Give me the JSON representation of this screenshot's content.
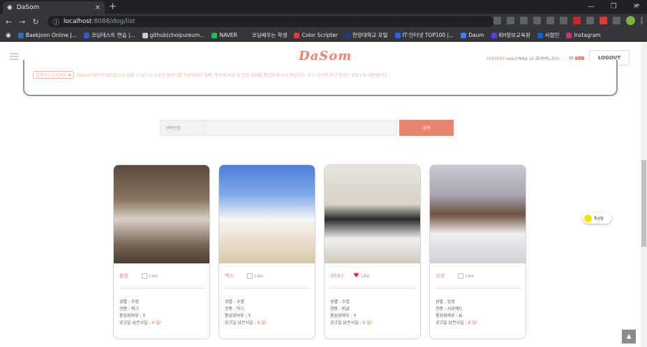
{
  "browser": {
    "tab_title": "DaSom",
    "url_host": "localhost",
    "url_rest": ":8088/dog/list",
    "bookmarks": [
      {
        "label": "Baekjoon Online J...",
        "color": "#2c6fb7"
      },
      {
        "label": "코딩테스트 연습 |...",
        "color": "#2f5bd3"
      },
      {
        "label": "github(choipureum...",
        "color": "#cccccc"
      },
      {
        "label": "NAVER",
        "color": "#03c75a"
      },
      {
        "label": "코딩배우는 학생",
        "color": "#35363a"
      },
      {
        "label": "Color Scripter",
        "color": "#e53935"
      },
      {
        "label": "한양대학교 포털",
        "color": "#1e3a8a"
      },
      {
        "label": "IT·인터넷 TOP100 |...",
        "color": "#2563eb"
      },
      {
        "label": "Daum",
        "color": "#3b82f6"
      },
      {
        "label": "KH정보교육원",
        "color": "#4f46e5"
      },
      {
        "label": "사람인",
        "color": "#0a66c2"
      },
      {
        "label": "Instagram",
        "color": "#c13584"
      }
    ],
    "more": "»"
  },
  "header": {
    "logo": "DaSom",
    "role": "[다이어]",
    "welcome": " poo1994 님 환영합니다!",
    "mail_count": "1+",
    "logout": "LOGOUT"
  },
  "notice": {
    "tag": "알림이 | 공지사항 ▼",
    "text": "DaSom에서 안내드립니다. 입양 시 반드시 보호자 동의서를 작성하셔야 하며, 중성화 여부 및 건강 상태를 확인해 주시기 바랍니다. 공고 기간이 지난 아이는 보호소로 이관됩니다."
  },
  "search": {
    "select_label": "선택안함",
    "button": "검색"
  },
  "dogs": [
    {
      "name": "불랑",
      "like_label": "Like",
      "liked": false,
      "gender": "성별 : 수컷",
      "breed": "견종 : 퍼그",
      "neutered": "중성화여부 : Y",
      "days_label": "공고일 남은시일 : ",
      "days": "4 일!"
    },
    {
      "name": "백스",
      "like_label": "Like",
      "liked": false,
      "gender": "성별 : 수컷",
      "breed": "견종 : 믹스",
      "neutered": "중성화여부 : Y",
      "days_label": "공고일 남은시일 : ",
      "days": "9 일!"
    },
    {
      "name": "바나나",
      "like_label": "Like",
      "liked": true,
      "gender": "성별 : 수컷",
      "breed": "견종 : 비글",
      "neutered": "중성화여부 : Y",
      "days_label": "공고일 남은시일 : ",
      "days": "9 일!"
    },
    {
      "name": "코코",
      "like_label": "Like",
      "liked": false,
      "gender": "성별 : 암컷",
      "breed": "견종 : 사모예드",
      "neutered": "중성화여부 : N",
      "days_label": "공고일 남은시일 : ",
      "days": "9 일!"
    }
  ],
  "kakao": "톡상담",
  "to_top": "▲"
}
